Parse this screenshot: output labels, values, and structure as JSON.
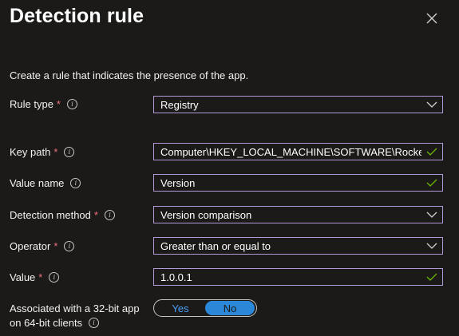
{
  "panel": {
    "title": "Detection rule",
    "intro": "Create a rule that indicates the presence of the app."
  },
  "fields": {
    "rule_type": {
      "label": "Rule type",
      "value": "Registry"
    },
    "key_path": {
      "label": "Key path",
      "value": "Computer\\HKEY_LOCAL_MACHINE\\SOFTWARE\\Rockenro..."
    },
    "value_name": {
      "label": "Value name",
      "value": "Version"
    },
    "detection_method": {
      "label": "Detection method",
      "value": "Version comparison"
    },
    "operator": {
      "label": "Operator",
      "value": "Greater than or equal to"
    },
    "value": {
      "label": "Value",
      "value": "1.0.0.1"
    },
    "assoc": {
      "label_line1": "Associated with a 32-bit app",
      "label_line2": "on 64-bit clients",
      "yes": "Yes",
      "no": "No",
      "selected": "No"
    }
  },
  "colors": {
    "required": "#f1707b",
    "focus_border": "#b19cd9",
    "valid": "#6bb700",
    "toggle_on": "#2b88d8",
    "link": "#479ef5"
  }
}
